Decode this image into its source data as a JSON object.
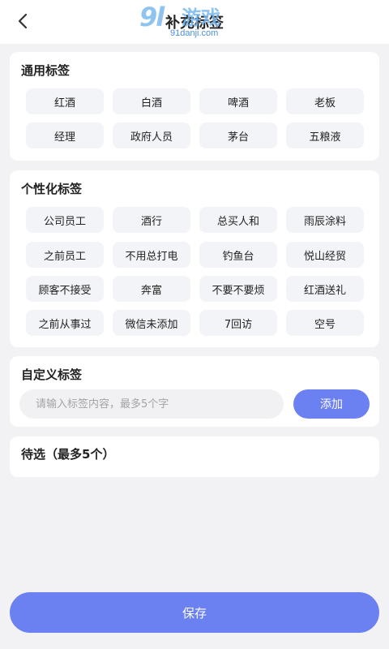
{
  "header": {
    "title": "补充标签",
    "back_icon": "chevron-left-icon",
    "watermark": {
      "mark": "9l",
      "text": "游戏",
      "url": "91danji.com"
    }
  },
  "general": {
    "title": "通用标签",
    "tags": [
      "红酒",
      "白酒",
      "啤酒",
      "老板",
      "经理",
      "政府人员",
      "茅台",
      "五粮液"
    ]
  },
  "personal": {
    "title": "个性化标签",
    "tags": [
      "公司员工",
      "酒行",
      "总买人和",
      "雨辰涂料",
      "之前员工",
      "不用总打电",
      "钓鱼台",
      "悦山经贸",
      "顾客不接受",
      "奔富",
      "不要不要烦",
      "红酒送礼",
      "之前从事过",
      "微信未添加",
      "7回访",
      "空号"
    ]
  },
  "custom": {
    "title": "自定义标签",
    "placeholder": "请输入标签内容，最多5个字",
    "add_label": "添加"
  },
  "pending": {
    "title": "待选（最多5个）"
  },
  "save_label": "保存",
  "colors": {
    "accent": "#6b80f1",
    "tag_bg": "#f3f4f7",
    "page_bg": "#f2f2f4"
  }
}
